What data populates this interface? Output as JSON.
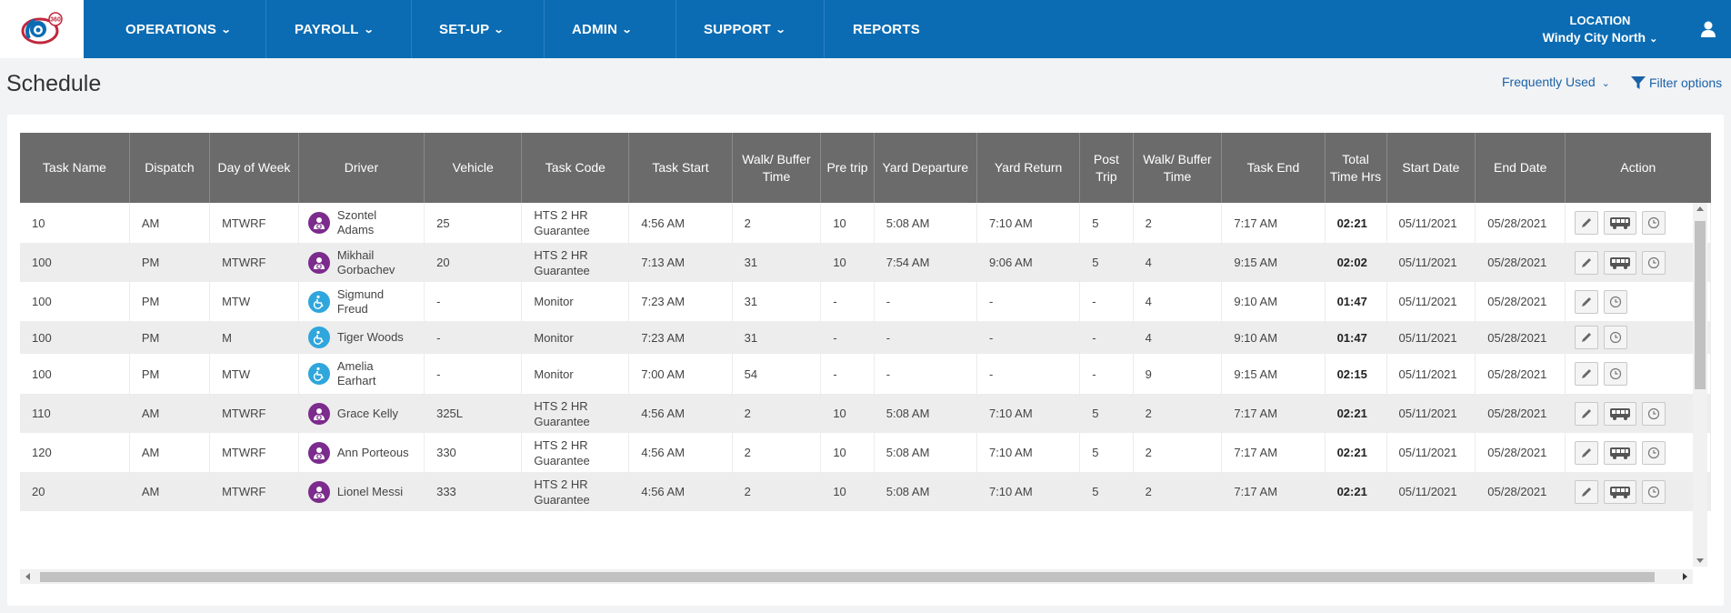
{
  "logo": {
    "text": "360"
  },
  "nav": {
    "operations": "OPERATIONS",
    "payroll": "PAYROLL",
    "setup": "SET-UP",
    "admin": "ADMIN",
    "support": "SUPPORT",
    "reports": "REPORTS"
  },
  "location": {
    "label": "LOCATION",
    "value": "Windy City North"
  },
  "page": {
    "title": "Schedule",
    "frequently_used": "Frequently Used",
    "filter_options": "Filter options"
  },
  "table": {
    "columns": [
      "Task Name",
      "Dispatch",
      "Day of Week",
      "Driver",
      "Vehicle",
      "Task Code",
      "Task Start",
      "Walk/ Buffer Time",
      "Pre trip",
      "Yard Departure",
      "Yard Return",
      "Post Trip",
      "Walk/ Buffer Time",
      "Task End",
      "Total Time Hrs",
      "Start Date",
      "End Date",
      "Action"
    ],
    "rows": [
      {
        "task": "10",
        "dispatch": "AM",
        "dow": "MTWRF",
        "driver": "Szontel Adams",
        "role": "driver",
        "vehicle": "25",
        "code": "HTS 2 HR Guarantee",
        "start": "4:56 AM",
        "walk1": "2",
        "pre": "10",
        "ydep": "5:08 AM",
        "yret": "7:10 AM",
        "post": "5",
        "walk2": "2",
        "end": "7:17 AM",
        "total": "02:21",
        "sdate": "05/11/2021",
        "edate": "05/28/2021",
        "bus": true
      },
      {
        "task": "100",
        "dispatch": "PM",
        "dow": "MTWRF",
        "driver": "Mikhail Gorbachev",
        "role": "driver",
        "vehicle": "20",
        "code": "HTS 2 HR Guarantee",
        "start": "7:13 AM",
        "walk1": "31",
        "pre": "10",
        "ydep": "7:54 AM",
        "yret": "9:06 AM",
        "post": "5",
        "walk2": "4",
        "end": "9:15 AM",
        "total": "02:02",
        "sdate": "05/11/2021",
        "edate": "05/28/2021",
        "bus": true
      },
      {
        "task": "100",
        "dispatch": "PM",
        "dow": "MTW",
        "driver": "Sigmund Freud",
        "role": "monitor",
        "vehicle": "-",
        "code": "Monitor",
        "start": "7:23 AM",
        "walk1": "31",
        "pre": "-",
        "ydep": "-",
        "yret": "-",
        "post": "-",
        "walk2": "4",
        "end": "9:10 AM",
        "total": "01:47",
        "sdate": "05/11/2021",
        "edate": "05/28/2021",
        "bus": false
      },
      {
        "task": "100",
        "dispatch": "PM",
        "dow": "M",
        "driver": "Tiger Woods",
        "role": "monitor",
        "vehicle": "-",
        "code": "Monitor",
        "start": "7:23 AM",
        "walk1": "31",
        "pre": "-",
        "ydep": "-",
        "yret": "-",
        "post": "-",
        "walk2": "4",
        "end": "9:10 AM",
        "total": "01:47",
        "sdate": "05/11/2021",
        "edate": "05/28/2021",
        "bus": false
      },
      {
        "task": "100",
        "dispatch": "PM",
        "dow": "MTW",
        "driver": "Amelia Earhart",
        "role": "monitor",
        "vehicle": "-",
        "code": "Monitor",
        "start": "7:00 AM",
        "walk1": "54",
        "pre": "-",
        "ydep": "-",
        "yret": "-",
        "post": "-",
        "walk2": "9",
        "end": "9:15 AM",
        "total": "02:15",
        "sdate": "05/11/2021",
        "edate": "05/28/2021",
        "bus": false
      },
      {
        "task": "110",
        "dispatch": "AM",
        "dow": "MTWRF",
        "driver": "Grace Kelly",
        "role": "driver",
        "vehicle": "325L",
        "code": "HTS 2 HR Guarantee",
        "start": "4:56 AM",
        "walk1": "2",
        "pre": "10",
        "ydep": "5:08 AM",
        "yret": "7:10 AM",
        "post": "5",
        "walk2": "2",
        "end": "7:17 AM",
        "total": "02:21",
        "sdate": "05/11/2021",
        "edate": "05/28/2021",
        "bus": true
      },
      {
        "task": "120",
        "dispatch": "AM",
        "dow": "MTWRF",
        "driver": "Ann Porteous",
        "role": "driver",
        "vehicle": "330",
        "code": "HTS 2 HR Guarantee",
        "start": "4:56 AM",
        "walk1": "2",
        "pre": "10",
        "ydep": "5:08 AM",
        "yret": "7:10 AM",
        "post": "5",
        "walk2": "2",
        "end": "7:17 AM",
        "total": "02:21",
        "sdate": "05/11/2021",
        "edate": "05/28/2021",
        "bus": true
      },
      {
        "task": "20",
        "dispatch": "AM",
        "dow": "MTWRF",
        "driver": "Lionel Messi",
        "role": "driver",
        "vehicle": "333",
        "code": "HTS 2 HR Guarantee",
        "start": "4:56 AM",
        "walk1": "2",
        "pre": "10",
        "ydep": "5:08 AM",
        "yret": "7:10 AM",
        "post": "5",
        "walk2": "2",
        "end": "7:17 AM",
        "total": "02:21",
        "sdate": "05/11/2021",
        "edate": "05/28/2021",
        "bus": true
      }
    ]
  },
  "colors": {
    "nav_bg": "#0b6cb3",
    "header_bg": "#6b6b6b",
    "driver_avatar": "#7b2c8c",
    "monitor_avatar": "#2fa6dc",
    "link": "#1a62a8"
  },
  "icons": {
    "edit": "pencil-icon",
    "vehicle": "bus-icon",
    "time": "clock-icon",
    "driver": "driver-avatar-icon",
    "monitor": "wheelchair-icon",
    "filter": "funnel-icon",
    "user": "user-icon"
  }
}
